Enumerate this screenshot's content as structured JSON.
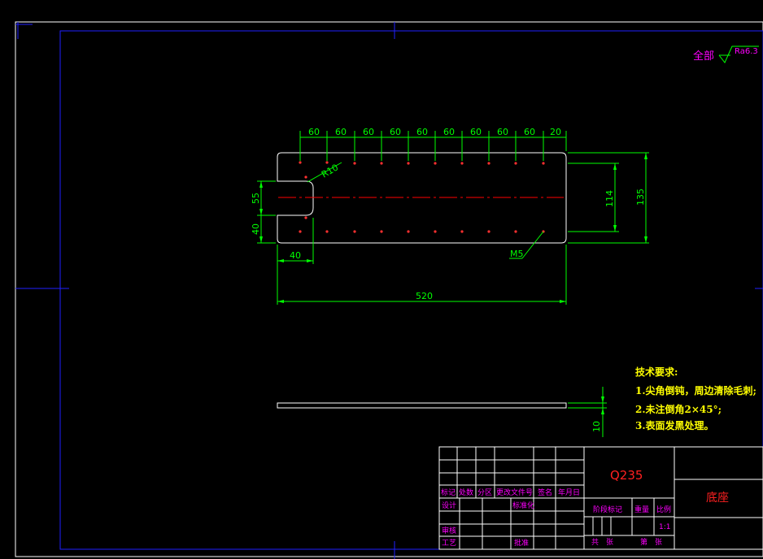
{
  "roughness": {
    "prefix": "全部",
    "value": "Ra6.3"
  },
  "dimensions": {
    "pitch": [
      "60",
      "60",
      "60",
      "60",
      "60",
      "60",
      "60",
      "60",
      "60",
      "20"
    ],
    "radius": "R10",
    "slot_width": "55",
    "slot_offset": "40",
    "slot_depth": "40",
    "overall_length": "520",
    "hole_span": "114",
    "overall_width": "135",
    "thread": "M5",
    "thickness": "10"
  },
  "tech_requirements": {
    "title": "技术要求:",
    "items": [
      "1.尖角倒钝，周边清除毛刺;",
      "2.未注倒角2×45°;",
      "3.表面发黑处理。"
    ]
  },
  "title_block": {
    "material": "Q235",
    "part_name": "底座",
    "headers": [
      "标记",
      "处数",
      "分区",
      "更改文件号",
      "签名",
      "年月日"
    ],
    "row_design": "设计",
    "row_standard": "标准化",
    "row_check": "审核",
    "row_process": "工艺",
    "row_approve": "批准",
    "stage_mark": "阶段标记",
    "weight": "重量",
    "scale": "比例",
    "scale_value": "1:1",
    "sheets_total": "共　张",
    "sheet_no": "第　张"
  },
  "colors": {
    "background": "#000000",
    "outline": "#ffffff",
    "dimension": "#00ff00",
    "border": "#0000ff",
    "title_block_text": "#ff00ff",
    "centerline": "#ff0000",
    "notes": "#ffff00"
  }
}
